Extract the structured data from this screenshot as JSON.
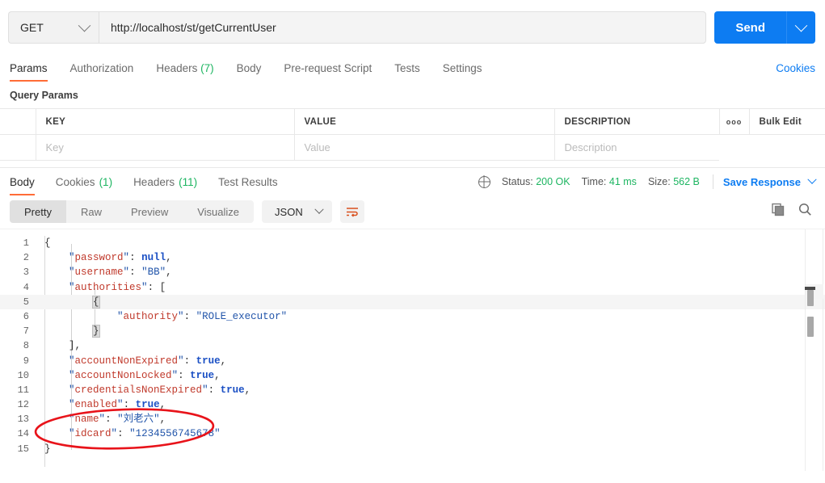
{
  "request": {
    "method": "GET",
    "method_icon": "chevron-down-icon",
    "url": "http://localhost/st/getCurrentUser",
    "send_label": "Send",
    "send_caret_icon": "chevron-down-icon",
    "tabs": [
      {
        "label": "Params",
        "count": "",
        "active": true
      },
      {
        "label": "Authorization",
        "count": "",
        "active": false
      },
      {
        "label": "Headers",
        "count": "(7)",
        "active": false
      },
      {
        "label": "Body",
        "count": "",
        "active": false
      },
      {
        "label": "Pre-request Script",
        "count": "",
        "active": false
      },
      {
        "label": "Tests",
        "count": "",
        "active": false
      },
      {
        "label": "Settings",
        "count": "",
        "active": false
      }
    ],
    "cookies_link": "Cookies"
  },
  "query_params": {
    "section_title": "Query Params",
    "headers": [
      "KEY",
      "VALUE",
      "DESCRIPTION"
    ],
    "more_icon": "ooo",
    "bulk_edit_label": "Bulk Edit",
    "placeholder_row": {
      "key": "Key",
      "value": "Value",
      "description": "Description"
    }
  },
  "response": {
    "tabs": [
      {
        "label": "Body",
        "count": "",
        "active": true
      },
      {
        "label": "Cookies",
        "count": "(1)",
        "active": false
      },
      {
        "label": "Headers",
        "count": "(11)",
        "active": false
      },
      {
        "label": "Test Results",
        "count": "",
        "active": false
      }
    ],
    "globe_icon": "globe-icon",
    "status_label": "Status:",
    "status_value": "200 OK",
    "time_label": "Time:",
    "time_value": "41 ms",
    "size_label": "Size:",
    "size_value": "562 B",
    "save_response_label": "Save Response",
    "save_response_caret": "chevron-down-icon",
    "format_tabs": [
      {
        "label": "Pretty",
        "active": true
      },
      {
        "label": "Raw",
        "active": false
      },
      {
        "label": "Preview",
        "active": false
      },
      {
        "label": "Visualize",
        "active": false
      }
    ],
    "language": "JSON",
    "language_caret": "chevron-down-icon",
    "wrap_icon": "word-wrap-icon",
    "copy_icon": "copy-icon",
    "search_icon": "search-icon"
  },
  "body_json": {
    "lines": [
      {
        "n": "1",
        "text": "{"
      },
      {
        "n": "2",
        "text": "    \"password\": null,"
      },
      {
        "n": "3",
        "text": "    \"username\": \"BB\","
      },
      {
        "n": "4",
        "text": "    \"authorities\": ["
      },
      {
        "n": "5",
        "text": "        {"
      },
      {
        "n": "6",
        "text": "            \"authority\": \"ROLE_executor\""
      },
      {
        "n": "7",
        "text": "        }"
      },
      {
        "n": "8",
        "text": "    ],"
      },
      {
        "n": "9",
        "text": "    \"accountNonExpired\": true,"
      },
      {
        "n": "10",
        "text": "    \"accountNonLocked\": true,"
      },
      {
        "n": "11",
        "text": "    \"credentialsNonExpired\": true,"
      },
      {
        "n": "12",
        "text": "    \"enabled\": true,"
      },
      {
        "n": "13",
        "text": "    \"name\": \"刘老六\","
      },
      {
        "n": "14",
        "text": "    \"idcard\": \"1234556745678\""
      },
      {
        "n": "15",
        "text": "}"
      }
    ],
    "values": {
      "password": "null",
      "username": "BB",
      "authority": "ROLE_executor",
      "accountNonExpired": "true",
      "accountNonLocked": "true",
      "credentialsNonExpired": "true",
      "enabled": "true",
      "name": "刘老六",
      "idcard": "1234556745678"
    }
  },
  "annotation": {
    "shape": "ellipse",
    "color": "#e8131a",
    "target": "name and idcard fields"
  },
  "colors": {
    "accent": "#ff6c37",
    "primary_blue": "#0d7cf2",
    "success_green": "#1db561",
    "key_red": "#c0392b",
    "string_blue": "#2255aa",
    "keyword_blue": "#1a4fc4"
  }
}
